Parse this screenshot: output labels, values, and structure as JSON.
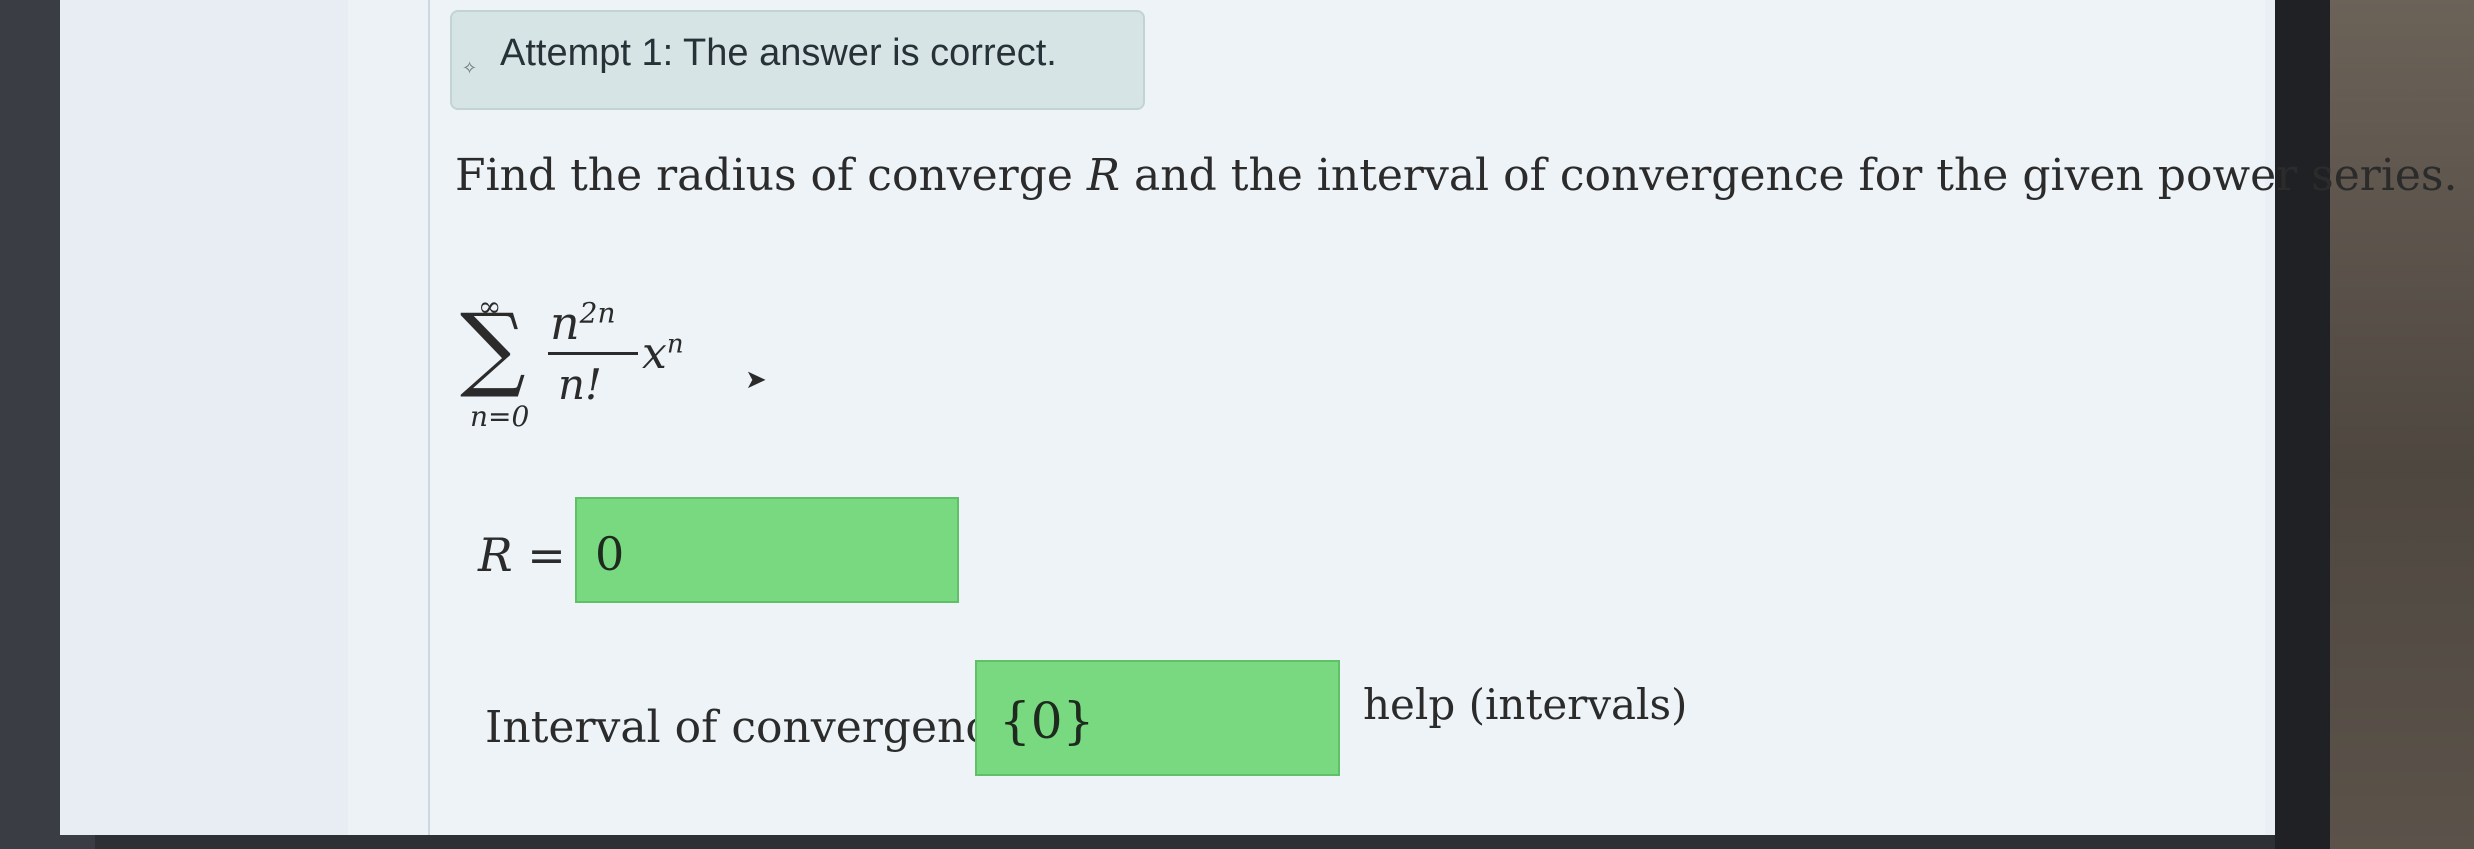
{
  "alert": {
    "icon": "info-icon",
    "text": "Attempt 1: The answer is correct."
  },
  "question": {
    "prompt_before": "Find the radius of converge ",
    "prompt_var": "R",
    "prompt_after": " and the interval of convergence for the given power series."
  },
  "series": {
    "upper_limit": "∞",
    "sigma": "∑",
    "lower_limit": "n=0",
    "numerator_base": "n",
    "numerator_exp": "2n",
    "denominator": "n!",
    "x_base": "x",
    "x_exp": "n"
  },
  "radius": {
    "label_var": "R",
    "label_eq": "=",
    "value": "0"
  },
  "interval": {
    "label": "Interval of convergence:",
    "value": "{0}",
    "help_text": "help (intervals)"
  },
  "colors": {
    "correct_fill": "#79d981",
    "alert_bg": "#d7e4e5"
  }
}
